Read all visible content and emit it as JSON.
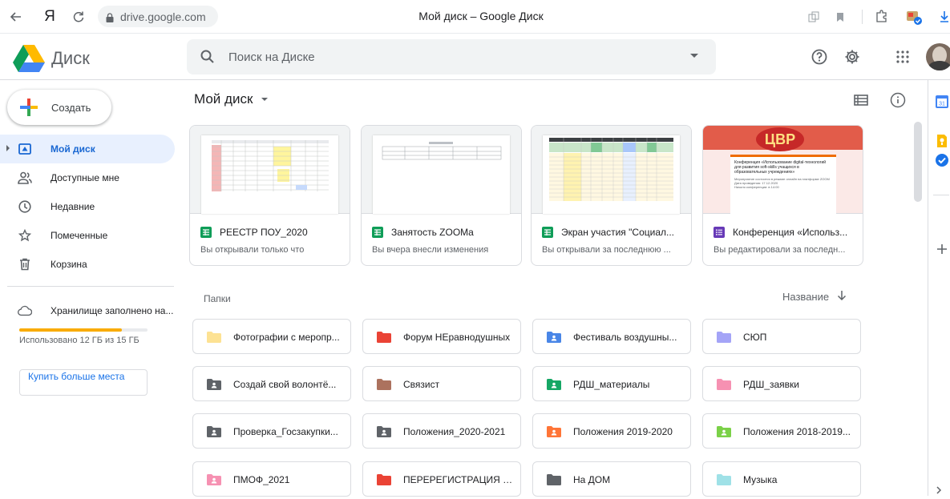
{
  "browser": {
    "back_icon": "arrow-left",
    "yandex_logo": "Я",
    "reload_icon": "reload",
    "url": "drive.google.com",
    "title": "Мой диск – Google Диск"
  },
  "header": {
    "product_name": "Диск",
    "search_placeholder": "Поиск на Диске"
  },
  "sidebar": {
    "create_label": "Создать",
    "items": [
      {
        "label": "Мой диск",
        "icon": "my-drive-icon",
        "active": true
      },
      {
        "label": "Доступные мне",
        "icon": "shared-icon",
        "active": false
      },
      {
        "label": "Недавние",
        "icon": "clock-icon",
        "active": false
      },
      {
        "label": "Помеченные",
        "icon": "star-icon",
        "active": false
      },
      {
        "label": "Корзина",
        "icon": "trash-icon",
        "active": false
      }
    ],
    "storage_label": "Хранилище заполнено на...",
    "storage_used_text": "Использовано 12 ГБ из 15 ГБ",
    "storage_fraction": 0.8,
    "buy_label": "Купить больше места"
  },
  "main": {
    "title": "Мой диск",
    "quick_access": [
      {
        "name": "РЕЕСТР ПОУ_2020",
        "sub": "Вы открывали только что",
        "type": "sheets"
      },
      {
        "name": "Занятость ZOOMa",
        "sub": "Вы вчера внесли изменения",
        "type": "sheets"
      },
      {
        "name": "Экран участия \"Социал...",
        "sub": "Вы открывали за последнюю ...",
        "type": "sheets"
      },
      {
        "name": "Конференция «Использ...",
        "sub": "Вы редактировали за последн...",
        "type": "forms"
      }
    ],
    "conference_card": {
      "banner_text": "ЦВР",
      "heading": "Конференция «Использование digital-технологий для развития soft-skills учащихся в образовательных учреждениях»",
      "body_lines": [
        "Мероприятие состоится в режиме онлайн на платформе ZOOM",
        "Дата проведения: 17.12.2020",
        "Начало конференции: в 14:00"
      ]
    },
    "folders_label": "Папки",
    "sort_label": "Название",
    "folders": [
      {
        "name": "Фотографии с меропр...",
        "color": "#fde293",
        "shared": false
      },
      {
        "name": "Форум НЕравнодушных",
        "color": "#ea4335",
        "shared": false
      },
      {
        "name": "Фестиваль воздушны...",
        "color": "#4986e7",
        "shared": true
      },
      {
        "name": "СЮП",
        "color": "#a4a4f7",
        "shared": false
      },
      {
        "name": "Создай свой волонтё...",
        "color": "#5f6368",
        "shared": true
      },
      {
        "name": "Связист",
        "color": "#ac725e",
        "shared": false
      },
      {
        "name": "РДШ_материалы",
        "color": "#16a765",
        "shared": true
      },
      {
        "name": "РДШ_заявки",
        "color": "#f691b2",
        "shared": false
      },
      {
        "name": "Проверка_Госзакупки...",
        "color": "#5f6368",
        "shared": true
      },
      {
        "name": "Положения_2020-2021",
        "color": "#5f6368",
        "shared": true
      },
      {
        "name": "Положения 2019-2020",
        "color": "#ff7537",
        "shared": true
      },
      {
        "name": "Положения 2018-2019...",
        "color": "#7bd148",
        "shared": true
      },
      {
        "name": "ПМОФ_2021",
        "color": "#f691b2",
        "shared": true
      },
      {
        "name": "ПЕРЕРЕГИСТРАЦИЯ 2...",
        "color": "#ea4335",
        "shared": false
      },
      {
        "name": "На ДОМ",
        "color": "#5f6368",
        "shared": false
      },
      {
        "name": "Музыка",
        "color": "#9fe1e7",
        "shared": false
      }
    ]
  },
  "colors": {
    "accent": "#1a73e8",
    "active_bg": "#e8f0fe",
    "storage": "#f9ab00",
    "sheets": "#0f9d58",
    "forms": "#673ab7"
  },
  "right_panel_icons": [
    "calendar-icon",
    "keep-icon",
    "tasks-icon",
    "add-addon-icon"
  ]
}
